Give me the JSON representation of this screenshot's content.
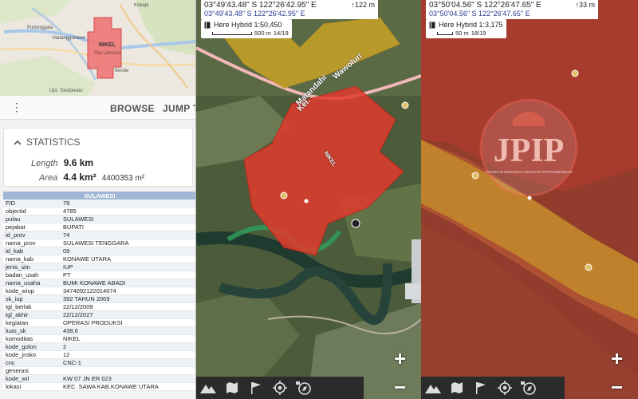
{
  "mini_map": {
    "labels": {
      "kokapi": "Kokapi",
      "pudonggala": "Pudonggala",
      "matanggonawe": "Matanggonawe",
      "nikel": "NIKEL",
      "ota_lamonia": "Ota Lamonia",
      "beride": "Beride",
      "upt_tondowatu": "Upt. Tondowatu"
    },
    "polygon_color": "#f07575"
  },
  "toolbar": {
    "browse_label": "BROWSE",
    "jump_label": "JUMP T"
  },
  "statistics": {
    "header": "STATISTICS",
    "length_label": "Length",
    "length_value": "9.6 km",
    "area_label": "Area",
    "area_value": "4.4 km²",
    "area_extra": "4400353 m²"
  },
  "attributes": {
    "title": "SULAWESI",
    "rows": [
      {
        "k": "FID",
        "v": "79"
      },
      {
        "k": "objectid",
        "v": "4785"
      },
      {
        "k": "pulau",
        "v": "SULAWESI"
      },
      {
        "k": "pejabat",
        "v": "BUPATI"
      },
      {
        "k": "id_prov",
        "v": "74"
      },
      {
        "k": "nama_prov",
        "v": "SULAWESI TENGGARA"
      },
      {
        "k": "id_kab",
        "v": "09"
      },
      {
        "k": "nama_kab",
        "v": "KONAWE UTARA"
      },
      {
        "k": "jenis_izin",
        "v": "IUP"
      },
      {
        "k": "badan_usah",
        "v": "PT"
      },
      {
        "k": "nama_usaha",
        "v": "BUMI KONAWE ABADI"
      },
      {
        "k": "kode_wiup",
        "v": "3474092122014074"
      },
      {
        "k": "sk_iup",
        "v": "392 TAHUN 2009"
      },
      {
        "k": "tgl_berlak",
        "v": "22/12/2009"
      },
      {
        "k": "tgl_akhir",
        "v": "22/12/2027"
      },
      {
        "k": "kegiatan",
        "v": "OPERASI PRODUKSI"
      },
      {
        "k": "luas_sk",
        "v": "438,6"
      },
      {
        "k": "komoditas",
        "v": "NIKEL"
      },
      {
        "k": "kode_golon",
        "v": "2"
      },
      {
        "k": "kode_jnsko",
        "v": "12"
      },
      {
        "k": "cnc",
        "v": "CNC-1"
      },
      {
        "k": "generasi",
        "v": ""
      },
      {
        "k": "kode_wil",
        "v": "KW 07 JN ER 023"
      },
      {
        "k": "lokasi",
        "v": "KEC. SAWA KAB.KONAWE UTARA"
      }
    ]
  },
  "map_mid": {
    "coord_main": "03°49'43.48\" S 122°26'42.95\" E",
    "coord_sub": "03°49'43.48\" S 122°26'42.95\" E",
    "altitude": "↑122 m",
    "layer_name": "Here Hybrid 1:50,450",
    "scale_label": "500 m",
    "zoom_level": "14/19",
    "polygon_label": "NIKEL",
    "road_label_1": "Wawoluri",
    "road_label_2": "Matandahi",
    "road_label_3": "Kel."
  },
  "map_right": {
    "coord_main": "03°50'04.56\" S 122°26'47.65\" E",
    "coord_sub": "03°50'04.56\" S 122°26'47.65\" E",
    "altitude": "↑33 m",
    "layer_name": "Here Hybrid 1:3,175",
    "scale_label": "50 m",
    "zoom_level": "18/19",
    "watermark_text": "JPIP",
    "watermark_caption": "JARINGAN PEMANTAU INDUSTRI PERTAMBANGAN"
  },
  "controls": {
    "zoom_in": "+",
    "zoom_out": "−"
  },
  "colors": {
    "mining_polygon": "#e23a2e",
    "concession_yellow": "#c9a227",
    "toolbar_text": "#555555"
  }
}
